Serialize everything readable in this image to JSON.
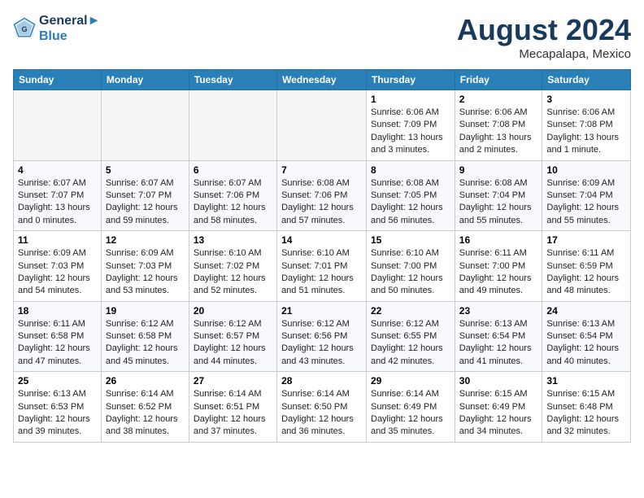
{
  "header": {
    "logo_line1": "General",
    "logo_line2": "Blue",
    "month_year": "August 2024",
    "location": "Mecapalapa, Mexico"
  },
  "days_of_week": [
    "Sunday",
    "Monday",
    "Tuesday",
    "Wednesday",
    "Thursday",
    "Friday",
    "Saturday"
  ],
  "weeks": [
    [
      {
        "day": "",
        "empty": true
      },
      {
        "day": "",
        "empty": true
      },
      {
        "day": "",
        "empty": true
      },
      {
        "day": "",
        "empty": true
      },
      {
        "day": "1",
        "sunrise": "6:06 AM",
        "sunset": "7:09 PM",
        "daylight": "13 hours and 3 minutes."
      },
      {
        "day": "2",
        "sunrise": "6:06 AM",
        "sunset": "7:08 PM",
        "daylight": "13 hours and 2 minutes."
      },
      {
        "day": "3",
        "sunrise": "6:06 AM",
        "sunset": "7:08 PM",
        "daylight": "13 hours and 1 minute."
      }
    ],
    [
      {
        "day": "4",
        "sunrise": "6:07 AM",
        "sunset": "7:07 PM",
        "daylight": "13 hours and 0 minutes."
      },
      {
        "day": "5",
        "sunrise": "6:07 AM",
        "sunset": "7:07 PM",
        "daylight": "12 hours and 59 minutes."
      },
      {
        "day": "6",
        "sunrise": "6:07 AM",
        "sunset": "7:06 PM",
        "daylight": "12 hours and 58 minutes."
      },
      {
        "day": "7",
        "sunrise": "6:08 AM",
        "sunset": "7:06 PM",
        "daylight": "12 hours and 57 minutes."
      },
      {
        "day": "8",
        "sunrise": "6:08 AM",
        "sunset": "7:05 PM",
        "daylight": "12 hours and 56 minutes."
      },
      {
        "day": "9",
        "sunrise": "6:08 AM",
        "sunset": "7:04 PM",
        "daylight": "12 hours and 55 minutes."
      },
      {
        "day": "10",
        "sunrise": "6:09 AM",
        "sunset": "7:04 PM",
        "daylight": "12 hours and 55 minutes."
      }
    ],
    [
      {
        "day": "11",
        "sunrise": "6:09 AM",
        "sunset": "7:03 PM",
        "daylight": "12 hours and 54 minutes."
      },
      {
        "day": "12",
        "sunrise": "6:09 AM",
        "sunset": "7:03 PM",
        "daylight": "12 hours and 53 minutes."
      },
      {
        "day": "13",
        "sunrise": "6:10 AM",
        "sunset": "7:02 PM",
        "daylight": "12 hours and 52 minutes."
      },
      {
        "day": "14",
        "sunrise": "6:10 AM",
        "sunset": "7:01 PM",
        "daylight": "12 hours and 51 minutes."
      },
      {
        "day": "15",
        "sunrise": "6:10 AM",
        "sunset": "7:00 PM",
        "daylight": "12 hours and 50 minutes."
      },
      {
        "day": "16",
        "sunrise": "6:11 AM",
        "sunset": "7:00 PM",
        "daylight": "12 hours and 49 minutes."
      },
      {
        "day": "17",
        "sunrise": "6:11 AM",
        "sunset": "6:59 PM",
        "daylight": "12 hours and 48 minutes."
      }
    ],
    [
      {
        "day": "18",
        "sunrise": "6:11 AM",
        "sunset": "6:58 PM",
        "daylight": "12 hours and 47 minutes."
      },
      {
        "day": "19",
        "sunrise": "6:12 AM",
        "sunset": "6:58 PM",
        "daylight": "12 hours and 45 minutes."
      },
      {
        "day": "20",
        "sunrise": "6:12 AM",
        "sunset": "6:57 PM",
        "daylight": "12 hours and 44 minutes."
      },
      {
        "day": "21",
        "sunrise": "6:12 AM",
        "sunset": "6:56 PM",
        "daylight": "12 hours and 43 minutes."
      },
      {
        "day": "22",
        "sunrise": "6:12 AM",
        "sunset": "6:55 PM",
        "daylight": "12 hours and 42 minutes."
      },
      {
        "day": "23",
        "sunrise": "6:13 AM",
        "sunset": "6:54 PM",
        "daylight": "12 hours and 41 minutes."
      },
      {
        "day": "24",
        "sunrise": "6:13 AM",
        "sunset": "6:54 PM",
        "daylight": "12 hours and 40 minutes."
      }
    ],
    [
      {
        "day": "25",
        "sunrise": "6:13 AM",
        "sunset": "6:53 PM",
        "daylight": "12 hours and 39 minutes."
      },
      {
        "day": "26",
        "sunrise": "6:14 AM",
        "sunset": "6:52 PM",
        "daylight": "12 hours and 38 minutes."
      },
      {
        "day": "27",
        "sunrise": "6:14 AM",
        "sunset": "6:51 PM",
        "daylight": "12 hours and 37 minutes."
      },
      {
        "day": "28",
        "sunrise": "6:14 AM",
        "sunset": "6:50 PM",
        "daylight": "12 hours and 36 minutes."
      },
      {
        "day": "29",
        "sunrise": "6:14 AM",
        "sunset": "6:49 PM",
        "daylight": "12 hours and 35 minutes."
      },
      {
        "day": "30",
        "sunrise": "6:15 AM",
        "sunset": "6:49 PM",
        "daylight": "12 hours and 34 minutes."
      },
      {
        "day": "31",
        "sunrise": "6:15 AM",
        "sunset": "6:48 PM",
        "daylight": "12 hours and 32 minutes."
      }
    ]
  ]
}
